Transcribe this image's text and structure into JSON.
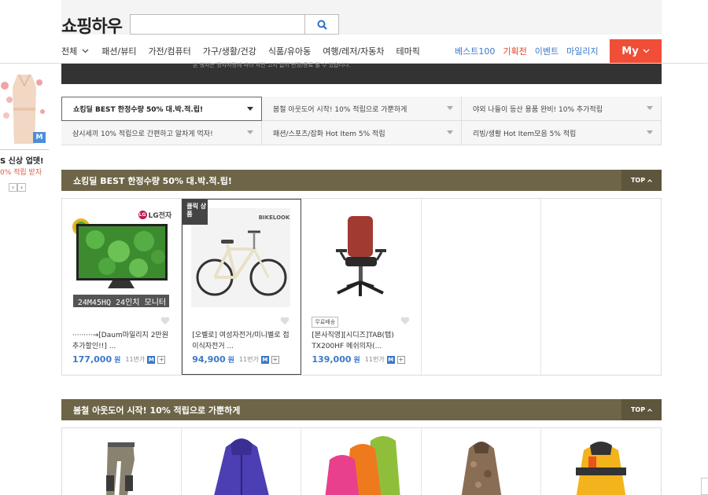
{
  "header": {
    "logo": "쇼핑하우",
    "search_placeholder": ""
  },
  "nav": {
    "all_label": "전체",
    "categories": [
      "패션/뷰티",
      "가전/컴퓨터",
      "가구/생활/건강",
      "식품/유아동",
      "여행/레저/자동차",
      "테마픽"
    ],
    "right": [
      {
        "label": "베스트100",
        "color": "#3a78c9"
      },
      {
        "label": "기획전",
        "color": "#e0402a"
      },
      {
        "label": "이벤트",
        "color": "#3a78c9"
      },
      {
        "label": "마일리지",
        "color": "#3a78c9"
      }
    ],
    "my_label": "My"
  },
  "banner": {
    "note": "본 행사는 정사사정에 따라 사전 고지 없이 변경/종료 될 수 있습니다."
  },
  "sidebar": {
    "title": "S 신상 업뎃!",
    "subtitle": "0% 적립 받자",
    "badge": "M",
    "prev": "‹",
    "next": "›"
  },
  "category_tabs": [
    "쇼킹딜 BEST 한정수량 50% 대.박.적.립!",
    "봄철 아웃도어 시작! 10% 적립으로 가뿐하게",
    "야외 나들이 등산 용품 완비! 10% 추가적립",
    "삼시세끼 10% 적립으로 간편하고 알차게 먹자!",
    "패션/스포츠/잡화 Hot Item 5% 적립",
    "리빙/생활 Hot Item모음 5% 적립"
  ],
  "section1": {
    "title": "쇼킹딜 BEST 한정수량 50% 대.박.적.립!",
    "top_label": "TOP"
  },
  "products": [
    {
      "name": "·········→[Daum마일리지 2만원 추가할인!!] ...",
      "price": "177,000",
      "won": "원",
      "shop": "11번가",
      "image_caption": "24M45HQ 24인치 모니터",
      "brand": "LG전자"
    },
    {
      "name": "[오벨로] 여성자전거/미니벨로 접이식자전거 ...",
      "price": "94,900",
      "won": "원",
      "shop": "11번가",
      "click_badge": "클릭 상품",
      "brand": "BIKELOOK"
    },
    {
      "name": "[본사직영][시디즈]TAB(탭) TX200HF 메쉬의자(...",
      "price": "139,000",
      "won": "원",
      "shop": "11번가",
      "free_shipping": "무료배송"
    }
  ],
  "section2": {
    "title": "봄철 아웃도어 시작! 10% 적립으로 가뿐하게",
    "top_label": "TOP"
  },
  "icons": {
    "mileage_badge": "M",
    "add": "+"
  }
}
